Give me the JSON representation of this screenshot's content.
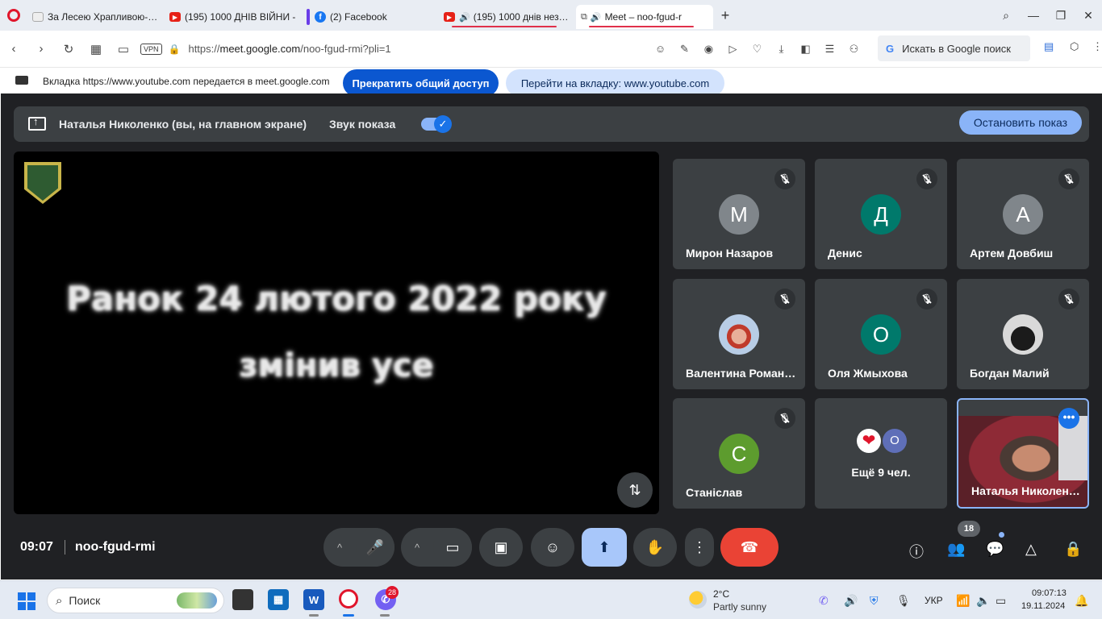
{
  "browser": {
    "tabs": [
      {
        "title": "За Лесею Храпливою-Щу",
        "icon": "document-icon"
      },
      {
        "title": "(195) 1000 ДНІВ ВІЙНИ -",
        "icon": "youtube-icon"
      },
      {
        "title": "(2) Facebook",
        "icon": "facebook-icon"
      },
      {
        "title": "(195) 1000 днів незлам",
        "icon": "youtube-icon"
      },
      {
        "title": "Meet – noo-fgud-r",
        "icon": "meet-icon"
      }
    ],
    "url_prefix": "https://",
    "url_host": "meet.google.com",
    "url_path": "/noo-fgud-rmi?pli=1",
    "vpn_label": "VPN",
    "search_placeholder": "Искать в Google поиск",
    "search_g": "G"
  },
  "sharebar": {
    "message": "Вкладка https://www.youtube.com передается в meet.google.com",
    "stop_label": "Прекратить общий доступ",
    "goto_label": "Перейти на вкладку: www.youtube.com"
  },
  "meet": {
    "presenter": "Наталья Николенко (вы, на главном экране)",
    "sound_label": "Звук показа",
    "sound_on": true,
    "stop_show_label": "Остановить показ",
    "stage_line1": "Ранок 24 лютого 2022 року",
    "stage_line2": "змінив усе",
    "participants": [
      {
        "initial": "М",
        "name": "Мирон Назаров",
        "color": "#80868b"
      },
      {
        "initial": "Д",
        "name": "Денис",
        "color": "#00796b"
      },
      {
        "initial": "А",
        "name": "Артем Довбиш",
        "color": "#80868b"
      },
      {
        "initial": "",
        "name": "Валентина Роман…",
        "color": "#9fb7d8"
      },
      {
        "initial": "О",
        "name": "Оля Жмыхова",
        "color": "#00796b"
      },
      {
        "initial": "",
        "name": "Богдан Малий",
        "color": "#d5d5d5"
      },
      {
        "initial": "С",
        "name": "Станіслав",
        "color": "#5d9c2e"
      }
    ],
    "more": {
      "av2_initial": "О",
      "label": "Ещё 9 чел."
    },
    "self_name": "Наталья Николен…",
    "time": "09:07",
    "meeting_code": "noo-fgud-rmi",
    "people_count": "18"
  },
  "taskbar": {
    "search_label": "Поиск",
    "viber_badge": "28",
    "temp": "2°C",
    "condition": "Partly sunny",
    "lang": "УКР",
    "time": "09:07:13",
    "date": "19.11.2024"
  }
}
